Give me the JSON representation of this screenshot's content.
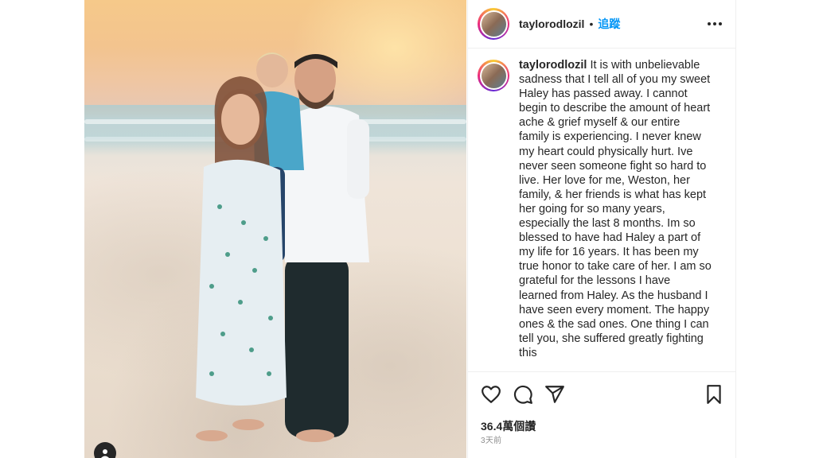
{
  "post": {
    "username": "taylorodlozil",
    "follow_label": "追蹤",
    "separator": "•",
    "caption": "It is with unbelievable sadness that I tell all of you my sweet Haley has passed away. I cannot begin to describe the amount of heart ache & grief myself & our entire family is experiencing. I never knew my heart could physically hurt. Ive never seen someone fight so hard to live. Her love for me, Weston, her family, & her friends is what has kept her going for so many years, especially the last 8 months. Im so blessed to have had Haley a part of my life for 16 years. It has been my true honor to take care of her. I am so grateful for the lessons I have learned from Haley. As the husband I have seen every moment. The happy ones & the sad ones. One thing I can tell you, she suffered greatly fighting this",
    "views": "36.4萬個讚",
    "time_ago": "3天前"
  },
  "icons": {
    "more": "more-options-icon",
    "like": "heart-icon",
    "comment": "comment-icon",
    "share": "share-icon",
    "save": "bookmark-icon",
    "tagged_user": "user-tag-icon"
  },
  "colors": {
    "follow_blue": "#0095f6",
    "text": "#262626",
    "muted": "#8e8e8e",
    "border": "#efefef"
  }
}
